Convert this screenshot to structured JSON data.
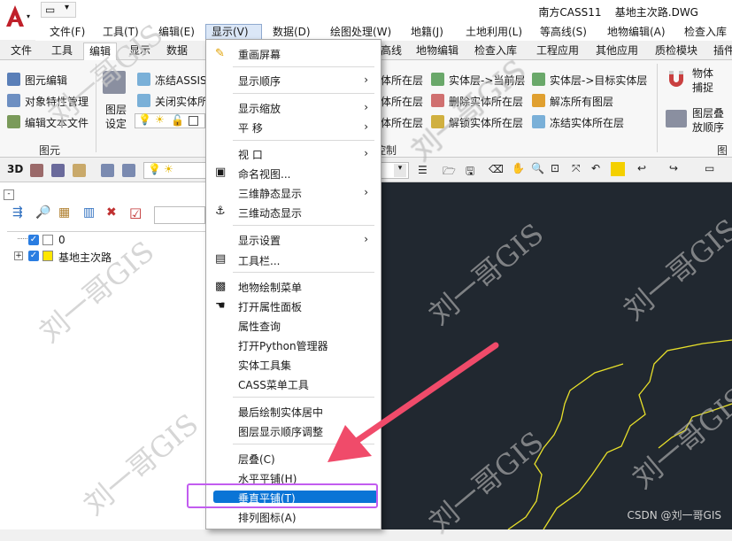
{
  "app": {
    "title": "南方CASS11",
    "doc": "基地主次路.DWG"
  },
  "menubar": [
    "文件(F)",
    "工具(T)",
    "编辑(E)",
    "显示(V)",
    "数据(D)",
    "绘图处理(W)",
    "地籍(J)",
    "土地利用(L)",
    "等高线(S)",
    "地物编辑(A)",
    "检查入库"
  ],
  "tabs": [
    "文件",
    "工具",
    "编辑",
    "显示",
    "数据",
    "高线",
    "地物编辑",
    "检查入库",
    "工程应用",
    "其他应用",
    "质检模块",
    "插件"
  ],
  "ribbon": {
    "g1": {
      "items": [
        "图元编辑",
        "对象特性管理",
        "编辑文本文件"
      ],
      "title": "图元"
    },
    "g2": {
      "big": "图层设定",
      "freeze": "冻结ASSIS",
      "close": "关闭实体所"
    },
    "g3": {
      "items": [
        "体所在层",
        "体所在层",
        "体所在层"
      ]
    },
    "g4": {
      "items": [
        "实体层->当前层",
        "删除实体所在层",
        "解锁实体所在层"
      ]
    },
    "g5": {
      "items": [
        "实体层->目标实体层",
        "解冻所有图层",
        "冻结实体所在层"
      ]
    },
    "g6": {
      "a": "物体捕捉",
      "b": "图层叠放顺序"
    },
    "control": "控制",
    "more": "图元"
  },
  "tree": {
    "items": [
      "0",
      "基地主次路"
    ]
  },
  "dropdown": {
    "items": [
      "重画屏幕",
      "显示顺序",
      "显示缩放",
      "平 移",
      "视 口",
      "命名视图...",
      "三维静态显示",
      "三维动态显示",
      "显示设置",
      "工具栏...",
      "地物绘制菜单",
      "打开属性面板",
      "属性查询",
      "打开Python管理器",
      "实体工具集",
      "CASS菜单工具",
      "最后绘制实体居中",
      "图层显示顺序调整",
      "层叠(C)",
      "水平平铺(H)",
      "垂直平铺(T)",
      "排列图标(A)"
    ],
    "highlighted": "垂直平铺(T)"
  },
  "watermark": "刘一哥GIS",
  "credit": "CSDN @刘一哥GIS",
  "colors": {
    "accent": "#0a74d6",
    "highlight_box": "#c25cf0",
    "arrow": "#f04b6a",
    "canvas": "#212830",
    "lines": "#e8e02a"
  }
}
